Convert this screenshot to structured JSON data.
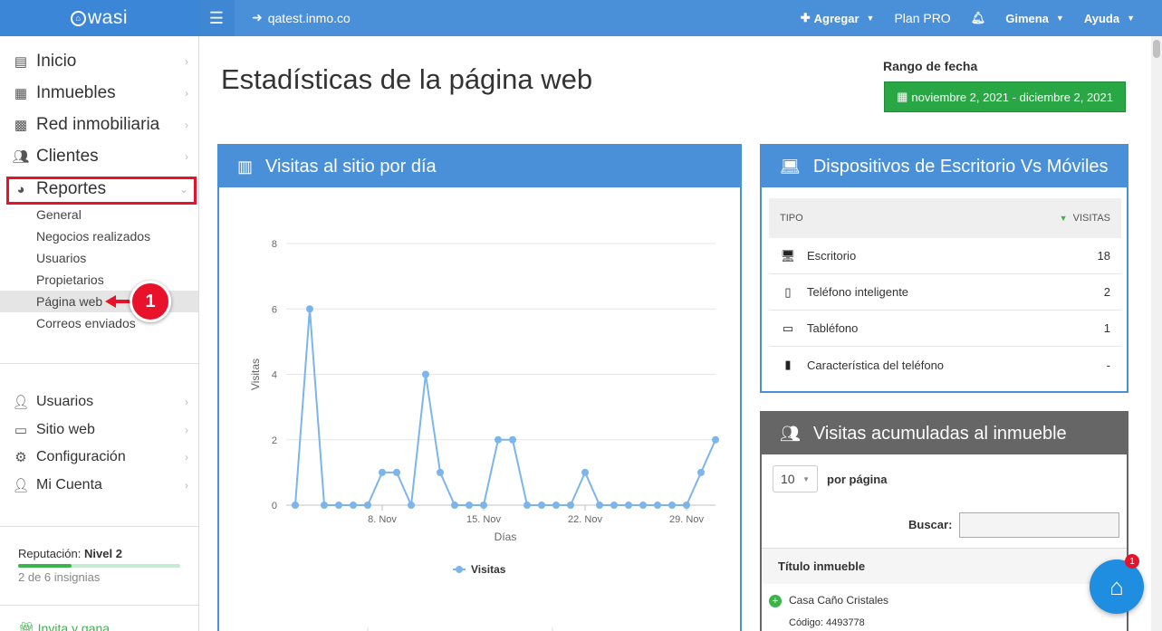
{
  "topbar": {
    "logo": "wasi",
    "site": "qatest.inmo.co",
    "add_label": "Agregar",
    "plan_label": "Plan PRO",
    "user_label": "Gimena",
    "help_label": "Ayuda"
  },
  "sidebar": {
    "items": [
      {
        "label": "Inicio",
        "icon": "home-icon"
      },
      {
        "label": "Inmuebles",
        "icon": "building-icon"
      },
      {
        "label": "Red inmobiliaria",
        "icon": "network-icon"
      },
      {
        "label": "Clientes",
        "icon": "users-icon"
      },
      {
        "label": "Reportes",
        "icon": "pie-chart-icon"
      }
    ],
    "subitems": [
      "General",
      "Negocios realizados",
      "Usuarios",
      "Propietarios",
      "Página web",
      "Correos enviados"
    ],
    "lower_items": [
      {
        "label": "Usuarios",
        "icon": "user-icon"
      },
      {
        "label": "Sitio web",
        "icon": "laptop-icon"
      },
      {
        "label": "Configuración",
        "icon": "gear-icon"
      },
      {
        "label": "Mi Cuenta",
        "icon": "account-icon"
      }
    ],
    "reputation_prefix": "Reputación:",
    "reputation_level": "Nivel 2",
    "reputation_progress": 0.33,
    "badges_text": "2 de 6 insignias",
    "invite_text": "Invita y gana"
  },
  "callout": {
    "number": "1"
  },
  "main": {
    "title": "Estadísticas de la página web",
    "range_label": "Rango de fecha",
    "range_value": "noviembre 2, 2021 - diciembre 2, 2021"
  },
  "visits_panel": {
    "title": "Visitas al sitio por día"
  },
  "chart_data": {
    "type": "line",
    "title": "",
    "xlabel": "Días",
    "ylabel": "Visitas",
    "ylim": [
      0,
      8
    ],
    "yticks": [
      0,
      2,
      4,
      6,
      8
    ],
    "xtick_labels": [
      {
        "label": "8. Nov",
        "day": 8
      },
      {
        "label": "15. Nov",
        "day": 15
      },
      {
        "label": "22. Nov",
        "day": 22
      },
      {
        "label": "29. Nov",
        "day": 29
      }
    ],
    "grid": true,
    "legend": "bottom",
    "color": "#7cb5ec",
    "series": [
      {
        "name": "Visitas",
        "x": [
          2,
          3,
          4,
          5,
          6,
          7,
          8,
          9,
          10,
          11,
          12,
          13,
          14,
          15,
          16,
          17,
          18,
          19,
          20,
          21,
          22,
          23,
          24,
          25,
          26,
          27,
          28,
          29,
          30,
          31
        ],
        "values": [
          0,
          6,
          0,
          0,
          0,
          0,
          1,
          1,
          0,
          4,
          1,
          0,
          0,
          0,
          2,
          2,
          0,
          0,
          0,
          0,
          1,
          0,
          0,
          0,
          0,
          0,
          0,
          0,
          1,
          2
        ]
      }
    ]
  },
  "devices_panel": {
    "title": "Dispositivos de Escritorio Vs Móviles",
    "col_type": "TIPO",
    "col_visits": "VISITAS",
    "rows": [
      {
        "label": "Escritorio",
        "value": "18",
        "icon": "desktop-icon"
      },
      {
        "label": "Teléfono inteligente",
        "value": "2",
        "icon": "smartphone-icon"
      },
      {
        "label": "Tabléfono",
        "value": "1",
        "icon": "tablet-icon"
      },
      {
        "label": "Característica del teléfono",
        "value": "-",
        "icon": "feature-phone-icon"
      }
    ]
  },
  "properties_panel": {
    "title": "Visitas acumuladas al inmueble",
    "per_page_value": "10",
    "per_page_label": "por página",
    "search_label": "Buscar:",
    "col_title": "Título inmueble",
    "row_title": "Casa Caño Cristales",
    "row_code": "Código: 4493778"
  },
  "chat": {
    "badge": "1"
  }
}
